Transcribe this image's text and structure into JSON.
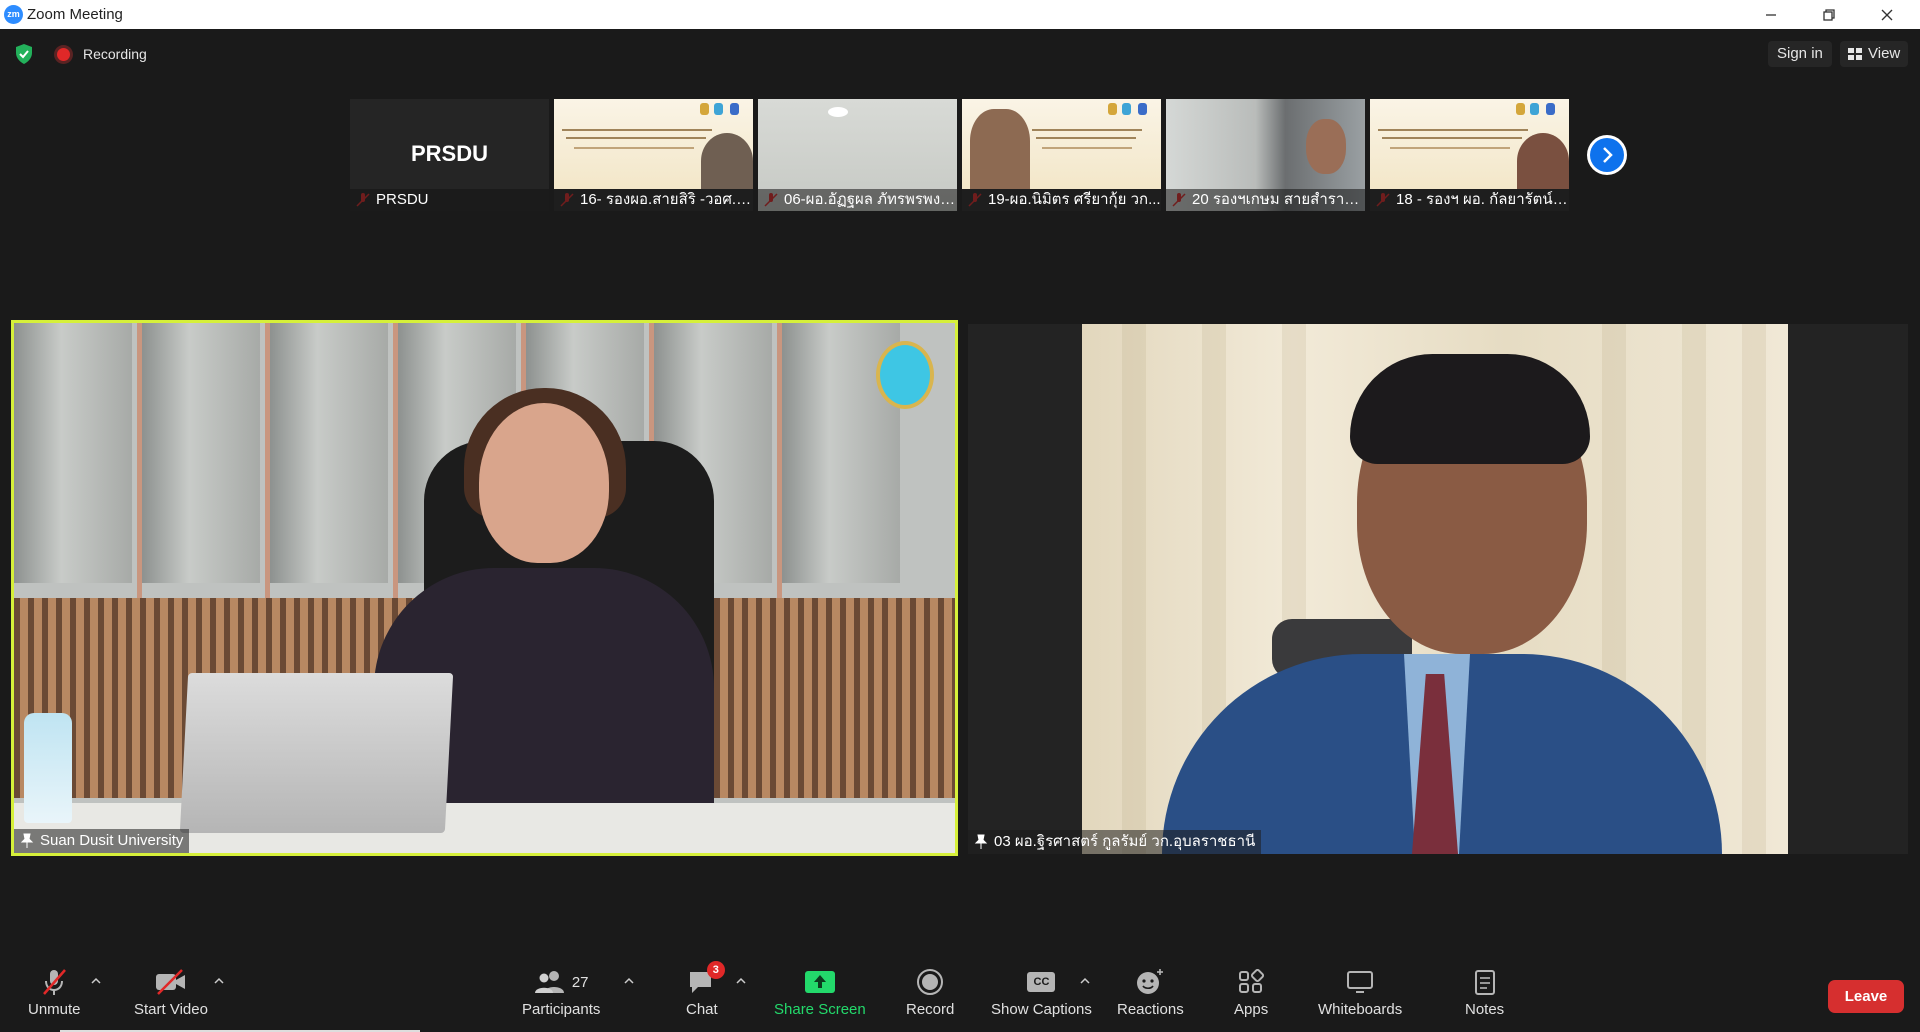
{
  "window": {
    "title": "Zoom Meeting",
    "logo_text": "zm"
  },
  "topbar": {
    "recording_label": "Recording",
    "sign_in_label": "Sign in",
    "view_label": "View"
  },
  "thumbnails": [
    {
      "name": "PRSDU",
      "display_text": "PRSDU",
      "type": "name-card"
    },
    {
      "name": "16- รองผอ.สายสิริ -วอศ.สุ...",
      "type": "slide-share"
    },
    {
      "name": "06-ผอ.อัฏฐผล ภัทรพรพงษ์...",
      "type": "camera"
    },
    {
      "name": "19-ผอ.นิมิตร ศรียากุ้ย วก...",
      "type": "slide-share"
    },
    {
      "name": "20 รองฯเกษม สายสำราญ ...",
      "type": "camera"
    },
    {
      "name": "18 - รองฯ ผอ. กัลยารัตน์ ...",
      "type": "slide-share"
    }
  ],
  "main_tiles": [
    {
      "name": "Suan Dusit University",
      "active_speaker": true
    },
    {
      "name": "03 ผอ.ฐิรศาสตร์ กูลรัมย์ วก.อุบลราชธานี",
      "active_speaker": false
    }
  ],
  "toolbar": {
    "unmute": "Unmute",
    "start_video": "Start Video",
    "participants": "Participants",
    "participants_count": "27",
    "chat": "Chat",
    "chat_badge": "3",
    "share_screen": "Share Screen",
    "record": "Record",
    "show_captions": "Show Captions",
    "captions_icon_text": "CC",
    "reactions": "Reactions",
    "apps": "Apps",
    "whiteboards": "Whiteboards",
    "notes": "Notes",
    "leave": "Leave"
  },
  "colors": {
    "accent_blue": "#0e72ed",
    "active_speaker_border": "#d6f03a",
    "share_green": "#23d96b",
    "leave_red": "#d62f2f",
    "recording_red": "#e02828"
  }
}
